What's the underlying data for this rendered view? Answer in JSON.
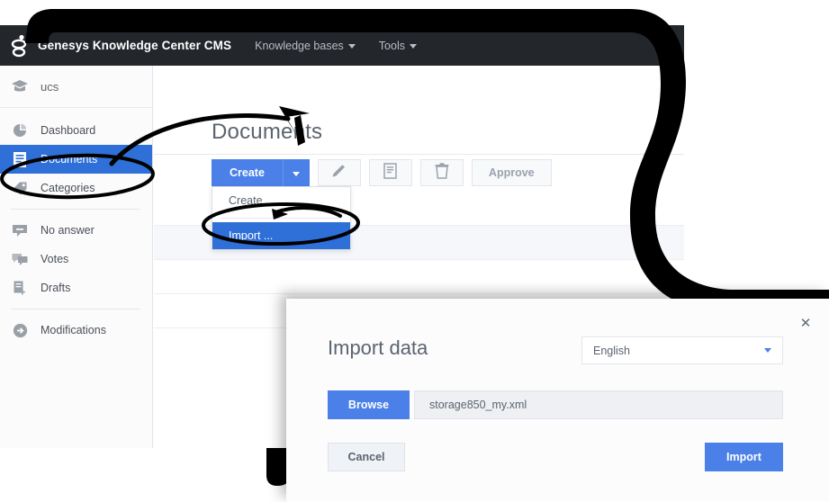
{
  "navbar": {
    "logo_icon": "genesys-logo-icon",
    "brand_title": "Genesys Knowledge Center CMS",
    "menus": [
      {
        "label": "Knowledge bases",
        "icon": "chevron-down-icon"
      },
      {
        "label": "Tools",
        "icon": "chevron-down-icon"
      }
    ]
  },
  "sidebar": {
    "knowledge_base": {
      "label": "ucs",
      "icon": "graduation-cap-icon"
    },
    "items": [
      {
        "label": "Dashboard",
        "icon": "pie-chart-icon",
        "active": false
      },
      {
        "label": "Documents",
        "icon": "document-icon",
        "active": true
      },
      {
        "label": "Categories",
        "icon": "tag-icon",
        "active": false
      },
      {
        "label": "No answer",
        "icon": "no-answer-icon",
        "active": false
      },
      {
        "label": "Votes",
        "icon": "votes-icon",
        "active": false
      },
      {
        "label": "Drafts",
        "icon": "drafts-icon",
        "active": false
      },
      {
        "label": "Modifications",
        "icon": "arrow-right-circle-icon",
        "active": false
      }
    ]
  },
  "content": {
    "page_title": "Documents",
    "toolbar": {
      "create_label": "Create",
      "create_caret_icon": "chevron-down-icon",
      "edit_icon": "pencil-icon",
      "copy_icon": "document-copy-icon",
      "delete_icon": "trash-icon",
      "approve_label": "Approve"
    },
    "create_menu": {
      "items": [
        {
          "label": "Create",
          "selected": false
        },
        {
          "label": "Import ...",
          "selected": true
        }
      ]
    }
  },
  "modal": {
    "title": "Import data",
    "close_icon": "close-icon",
    "language": {
      "value": "English",
      "caret_icon": "chevron-down-icon"
    },
    "browse_label": "Browse",
    "file_name": "storage850_my.xml",
    "cancel_label": "Cancel",
    "import_label": "Import"
  },
  "annotations": {
    "oval_documents": "highlight-oval-documents",
    "oval_import": "highlight-oval-import",
    "arrow_to_create_caret": "annotation-arrow-create-dropdown",
    "arrow_to_import": "annotation-arrow-import-item"
  },
  "colors": {
    "navbar_bg": "#23262b",
    "accent_blue": "#4a80e8",
    "selected_blue": "#2f6fd8",
    "sidebar_bg": "#fbfbfc",
    "annotation_black": "#000000",
    "text_muted": "#5b6470"
  }
}
